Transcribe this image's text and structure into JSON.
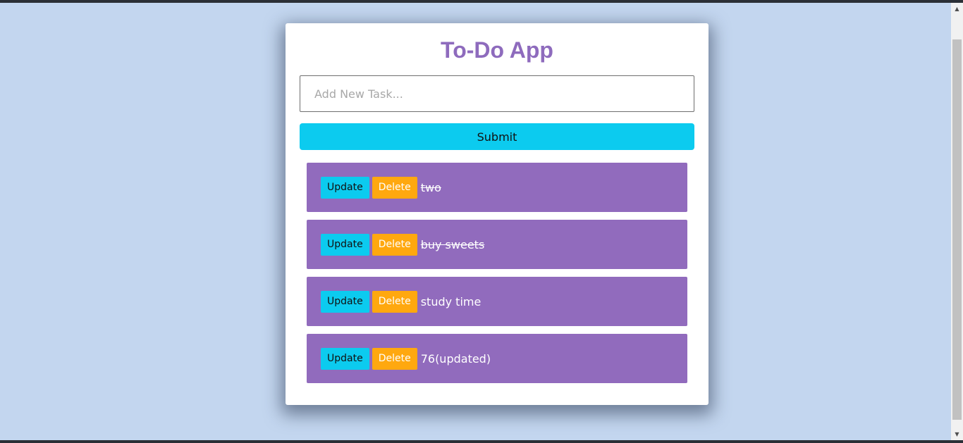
{
  "app": {
    "title": "To-Do App"
  },
  "form": {
    "input_value": "",
    "input_placeholder": "Add New Task...",
    "submit_label": "Submit"
  },
  "tasks": [
    {
      "text": "two",
      "completed": true,
      "update_label": "Update",
      "delete_label": "Delete"
    },
    {
      "text": "buy sweets",
      "completed": true,
      "update_label": "Update",
      "delete_label": "Delete"
    },
    {
      "text": "study time",
      "completed": false,
      "update_label": "Update",
      "delete_label": "Delete"
    },
    {
      "text": "76(updated)",
      "completed": false,
      "update_label": "Update",
      "delete_label": "Delete"
    }
  ],
  "colors": {
    "background": "#c3d6ef",
    "title": "#8e6bbd",
    "accent_cyan": "#0ccbef",
    "task_bg": "#916bbd",
    "delete_orange": "#ffa80f"
  },
  "icons": {
    "scroll_up": "triangle-up",
    "scroll_down": "triangle-down"
  }
}
